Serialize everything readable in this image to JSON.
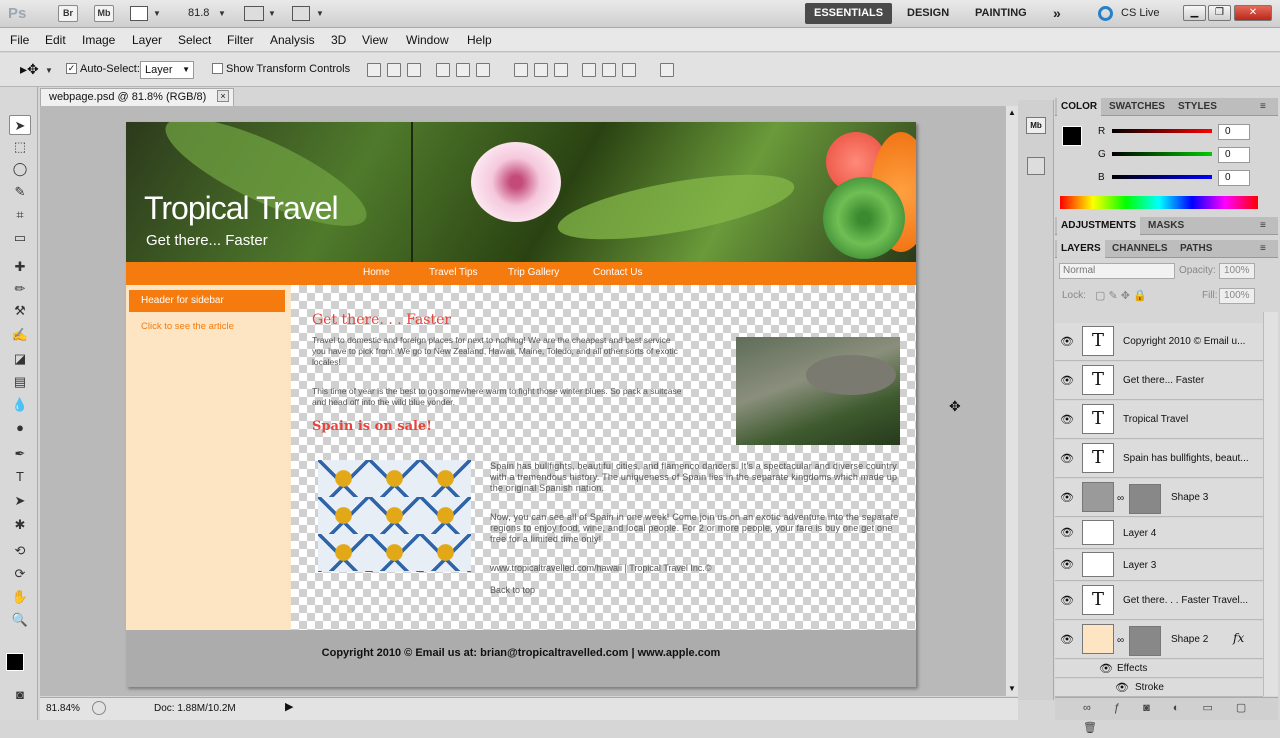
{
  "app": {
    "logo": "Ps",
    "bridge": "Br",
    "minibridge": "Mb",
    "zoom_value": "81.8",
    "workspaces": [
      "ESSENTIALS",
      "DESIGN",
      "PAINTING"
    ],
    "more": "»",
    "cslive": "CS Live"
  },
  "menu": [
    "File",
    "Edit",
    "Image",
    "Layer",
    "Select",
    "Filter",
    "Analysis",
    "3D",
    "View",
    "Window",
    "Help"
  ],
  "options": {
    "auto_select_label": "Auto-Select:",
    "auto_select_checked": "✓",
    "auto_select_value": "Layer",
    "show_transform_label": "Show Transform Controls"
  },
  "document": {
    "tab_title": "webpage.psd @ 81.8% (RGB/8)",
    "close": "×"
  },
  "status": {
    "zoom": "81.84%",
    "doc": "Doc: 1.88M/10.2M"
  },
  "webpage": {
    "title": "Tropical Travel",
    "tagline": "Get there... Faster",
    "nav": [
      "Home",
      "Travel Tips",
      "Trip Gallery",
      "Contact Us"
    ],
    "sidebar_header": "Header for sidebar",
    "sidebar_link": "Click to see the article",
    "heading1": "Get there. . . Faster",
    "para1": "Travel to domestic and foreign places for next to nothing! We are the cheapest and best service you have to pick from. We go to New Zealand, Hawaii, Maine, Toledo, and all other sorts of exotic locales!",
    "para2": "This time of year is the best to go somewhere warm to fight those winter blues. So pack a suitcase and head off into the wild blue yonder.",
    "heading2": "Spain is on sale!",
    "para3": "Spain has bullfights, beautiful cities, and flamenco dancers. It's a spectacular and diverse country with a tremendous history. The uniqueness of Spain lies in the separate kingdoms which made up the original Spanish nation.",
    "para4": "Now, you can see all of Spain in one week! Come join us on an exotic adventure into the separate regions to enjoy food, wine, and local people. For 2 or more people, your fare is buy one get one free for a limited time only!",
    "link_line": "www.tropicaltravelled.com/hawaii | Tropical Travel Inc.©",
    "back_top": "Back to top",
    "footer": "Copyright 2010 © Email us at: brian@tropicaltravelled.com   |   www.apple.com"
  },
  "color_panel": {
    "tabs": [
      "COLOR",
      "SWATCHES",
      "STYLES"
    ],
    "r_label": "R",
    "g_label": "G",
    "b_label": "B",
    "r": "0",
    "g": "0",
    "b": "0"
  },
  "adjust_panel": {
    "tabs": [
      "ADJUSTMENTS",
      "MASKS"
    ]
  },
  "layers_panel": {
    "tabs": [
      "LAYERS",
      "CHANNELS",
      "PATHS"
    ],
    "blend": "Normal",
    "opacity_label": "Opacity:",
    "opacity": "100%",
    "lock_label": "Lock:",
    "fill_label": "Fill:",
    "fill": "100%",
    "layers": [
      {
        "name": "Copyright 2010 © Email u...",
        "kind": "T"
      },
      {
        "name": "Get there... Faster",
        "kind": "T"
      },
      {
        "name": "Tropical Travel",
        "kind": "T"
      },
      {
        "name": "Spain has bullfights, beaut...",
        "kind": "T"
      },
      {
        "name": "Shape 3",
        "kind": "shape"
      },
      {
        "name": "Layer 4",
        "kind": "pixel"
      },
      {
        "name": "Layer 3",
        "kind": "pixel"
      },
      {
        "name": "Get there. . . Faster Travel...",
        "kind": "T"
      },
      {
        "name": "Shape 2",
        "kind": "shape"
      }
    ],
    "effects_label": "Effects",
    "stroke_label": "Stroke",
    "fx": "fx"
  },
  "colors": {
    "orange": "#f57b0f",
    "sidebar": "#fde5c4",
    "heading_red": "#e6433a",
    "essentials_bg": "#4a4a4a"
  }
}
